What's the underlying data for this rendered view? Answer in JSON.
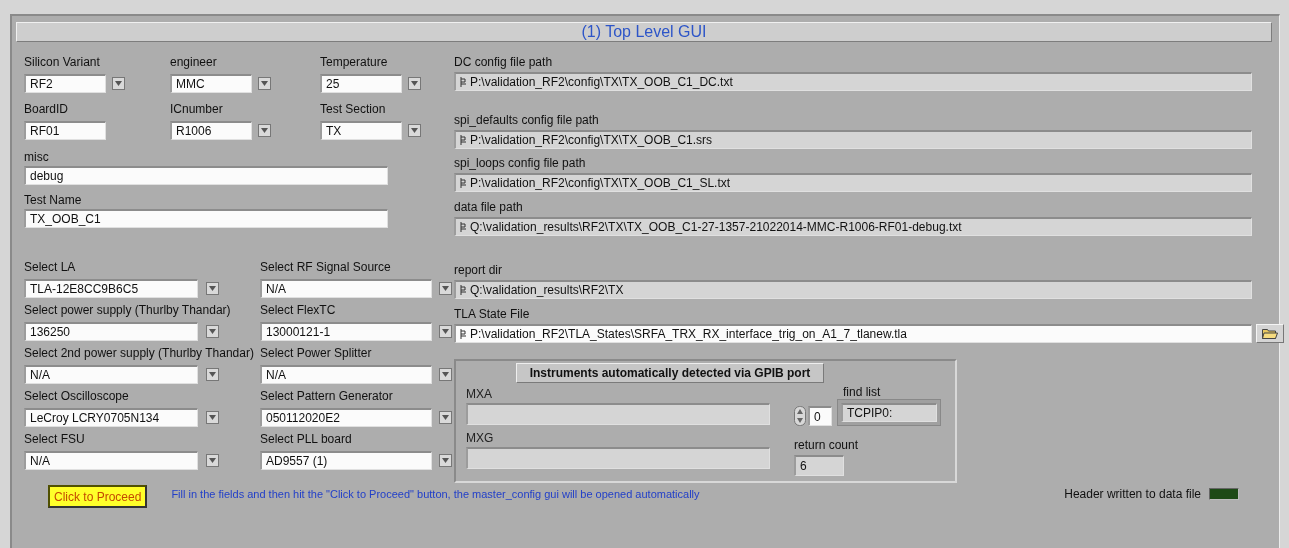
{
  "title": "(1) Top Level GUI",
  "settings": [
    {
      "label": "Silicon Variant",
      "value": "RF2",
      "kind": "combo"
    },
    {
      "label": "engineer",
      "value": "MMC",
      "kind": "combo"
    },
    {
      "label": "Temperature",
      "value": "25",
      "kind": "combo"
    },
    {
      "label": "BoardID",
      "value": "RF01",
      "kind": "text"
    },
    {
      "label": "ICnumber",
      "value": "R1006",
      "kind": "combo"
    },
    {
      "label": "Test Section",
      "value": "TX",
      "kind": "combo"
    }
  ],
  "notes": [
    {
      "label": "misc",
      "value": "debug"
    },
    {
      "label": "Test Name",
      "value": "TX_OOB_C1"
    }
  ],
  "selectors_left": [
    {
      "label": "Select LA",
      "value": "TLA-12E8CC9B6C5"
    },
    {
      "label": "Select power supply (Thurlby Thandar)",
      "value": "136250"
    },
    {
      "label": "Select 2nd power supply (Thurlby Thandar)",
      "value": "N/A"
    },
    {
      "label": "Select Oscilloscope",
      "value": "LeCroy LCRY0705N134"
    },
    {
      "label": "Select FSU",
      "value": "N/A"
    }
  ],
  "selectors_right": [
    {
      "label": "Select RF Signal Source",
      "value": "N/A"
    },
    {
      "label": "Select FlexTC",
      "value": "13000121-1"
    },
    {
      "label": "Select Power Splitter",
      "value": "N/A"
    },
    {
      "label": "Select Pattern Generator",
      "value": "050112020E2"
    },
    {
      "label": "Select PLL board",
      "value": "AD9557 (1)"
    }
  ],
  "paths": [
    {
      "label": "DC config file path",
      "value": "P:\\validation_RF2\\config\\TX\\TX_OOB_C1_DC.txt",
      "kind": "indicator"
    },
    {
      "label": "spi_defaults config file path",
      "value": "P:\\validation_RF2\\config\\TX\\TX_OOB_C1.srs",
      "kind": "indicator"
    },
    {
      "label": "spi_loops config file path",
      "value": "P:\\validation_RF2\\config\\TX\\TX_OOB_C1_SL.txt",
      "kind": "indicator"
    },
    {
      "label": "data file path",
      "value": "Q:\\validation_results\\RF2\\TX\\TX_OOB_C1-27-1357-21022014-MMC-R1006-RF01-debug.txt",
      "kind": "indicator"
    },
    {
      "label": "report dir",
      "value": "Q:\\validation_results\\RF2\\TX",
      "kind": "indicator"
    },
    {
      "label": "TLA State File",
      "value": "P:\\validation_RF2\\TLA_States\\SRFA_TRX_RX_interface_trig_on_A1_7_tlanew.tla",
      "kind": "control"
    }
  ],
  "detected": {
    "title": "Instruments automatically detected via GPIB port",
    "fields": [
      {
        "label": "MXA"
      },
      {
        "label": "MXG"
      }
    ],
    "find_list": {
      "label": "find list",
      "index": "0",
      "value": "TCPIP0:"
    },
    "return_count": {
      "label": "return count",
      "value": "6"
    }
  },
  "proceed_button": "Click to Proceed",
  "hint": "Fill in the fields and then hit the \"Click to Proceed\" button, the master_config gui will be opened automatically",
  "header_led": {
    "label": "Header written to data file",
    "on": false
  }
}
